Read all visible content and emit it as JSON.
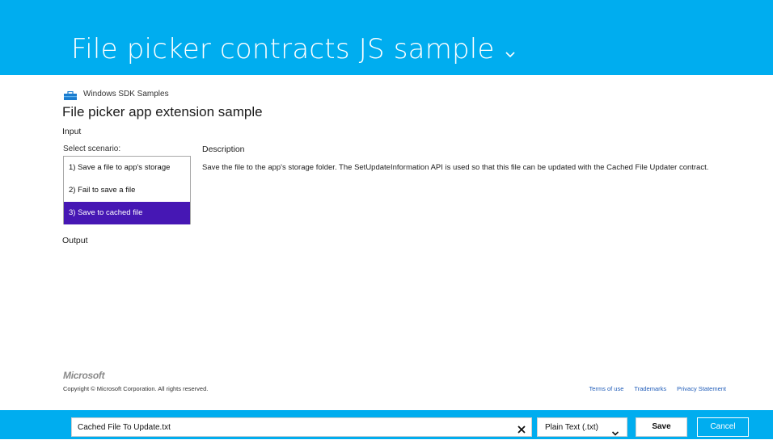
{
  "header": {
    "title": "File picker contracts JS sample",
    "chevron_icon": "chevron-down-icon",
    "background": "#00adef"
  },
  "sdk": {
    "label": "Windows SDK Samples",
    "icon": "toolbox-icon"
  },
  "sample": {
    "title": "File picker app extension sample"
  },
  "input_section": {
    "heading": "Input",
    "scenario_caption": "Select scenario:",
    "scenarios": [
      {
        "label": "1) Save a file to app's storage",
        "selected": false
      },
      {
        "label": "2) Fail to save a file",
        "selected": false
      },
      {
        "label": "3) Save to cached file",
        "selected": true
      }
    ],
    "selected_color": "#4617b4"
  },
  "description": {
    "heading": "Description",
    "text": "Save the file to the app's storage folder. The SetUpdateInformation API is used so that this file can be updated with the Cached File Updater contract."
  },
  "output_section": {
    "heading": "Output"
  },
  "footer": {
    "logo": "Microsoft",
    "copyright": "Copyright © Microsoft Corporation. All rights reserved.",
    "links": [
      "Terms of use",
      "Trademarks",
      "Privacy Statement"
    ]
  },
  "picker_bar": {
    "filename": "Cached File To Update.txt",
    "clear_icon": "close-icon",
    "filetype": "Plain Text (.txt)",
    "save_label": "Save",
    "cancel_label": "Cancel"
  }
}
